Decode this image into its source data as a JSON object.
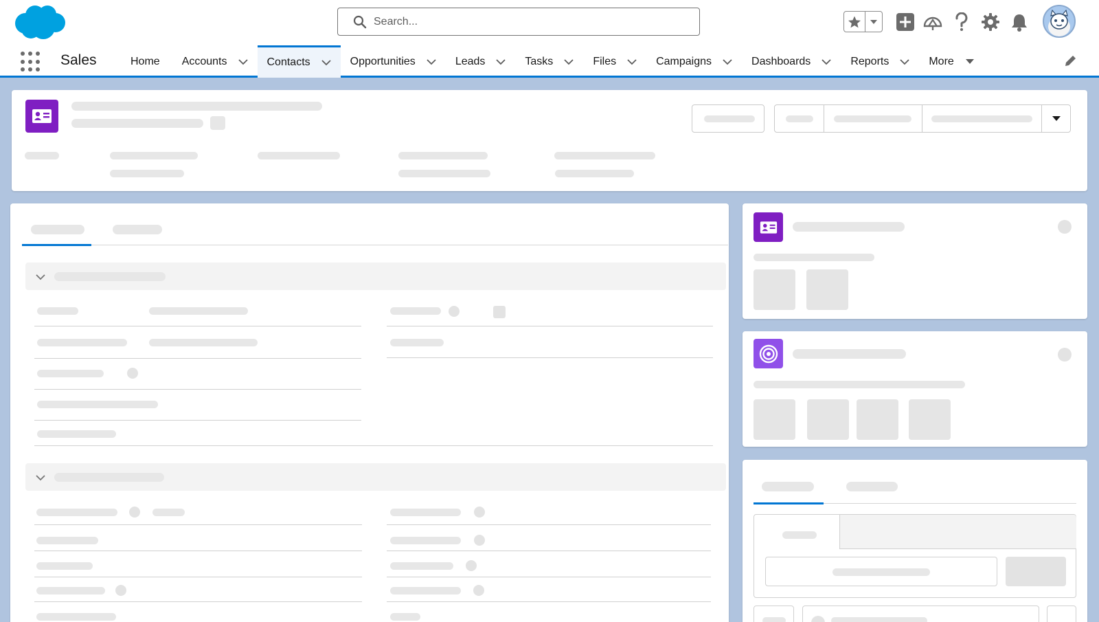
{
  "header": {
    "search_placeholder": "Search...",
    "icons": [
      "salesforce-cloud-logo",
      "search-icon",
      "favorites-star-icon",
      "chevron-down-icon",
      "add-icon",
      "trailhead-icon",
      "help-icon",
      "gear-icon",
      "bell-icon",
      "avatar"
    ]
  },
  "nav": {
    "app_name": "Sales",
    "tabs": [
      {
        "label": "Home",
        "has_menu": false
      },
      {
        "label": "Accounts",
        "has_menu": true
      },
      {
        "label": "Contacts",
        "has_menu": true,
        "active": true
      },
      {
        "label": "Opportunities",
        "has_menu": true
      },
      {
        "label": "Leads",
        "has_menu": true
      },
      {
        "label": "Tasks",
        "has_menu": true
      },
      {
        "label": "Files",
        "has_menu": true
      },
      {
        "label": "Campaigns",
        "has_menu": true
      },
      {
        "label": "Dashboards",
        "has_menu": true
      },
      {
        "label": "Reports",
        "has_menu": true
      }
    ],
    "more_label": "More"
  },
  "colors": {
    "brand_blue": "#0176d3",
    "contact_icon": "#7f1ec2",
    "campaign_icon": "#9050e9",
    "page_background": "#b0c4df",
    "skeleton": "#e7e7e7"
  },
  "state": {
    "loading": true
  }
}
